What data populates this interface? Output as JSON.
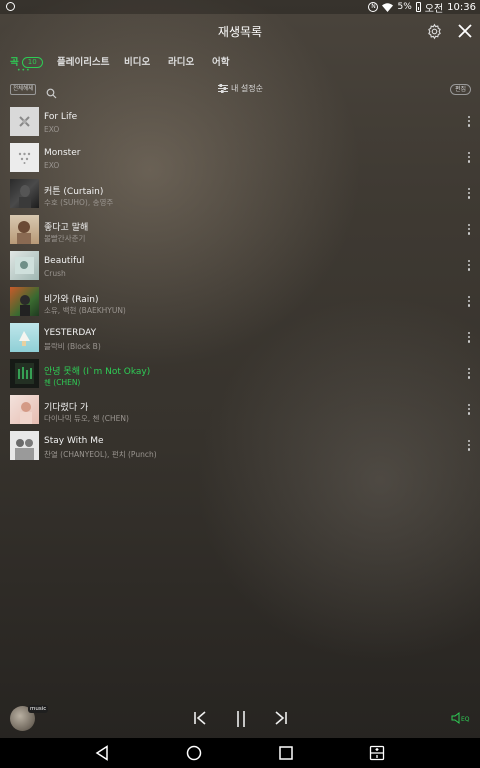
{
  "status_bar": {
    "battery": "5%",
    "time_prefix": "오전",
    "time": "10:36",
    "icons": [
      "app-ring-icon",
      "nfc-icon",
      "wifi-icon",
      "battery-icon"
    ]
  },
  "header": {
    "title": "재생목록",
    "icons": [
      "gear-icon",
      "close-icon"
    ]
  },
  "tabs": [
    {
      "label": "곡",
      "count": "10",
      "active": true
    },
    {
      "label": "플레이리스트",
      "active": false
    },
    {
      "label": "비디오",
      "active": false
    },
    {
      "label": "라디오",
      "active": false
    },
    {
      "label": "어학",
      "active": false
    }
  ],
  "toolbar": {
    "select_all": "전체해제",
    "sort_label": "내 설정순",
    "edit": "편집"
  },
  "songs": [
    {
      "title": "For Life",
      "artist": "EXO",
      "playing": false
    },
    {
      "title": "Monster",
      "artist": "EXO",
      "playing": false
    },
    {
      "title": "커튼 (Curtain)",
      "artist": "수호 (SUHO), 송영주",
      "playing": false
    },
    {
      "title": "좋다고 말해",
      "artist": "볼빨간사춘기",
      "playing": false
    },
    {
      "title": "Beautiful",
      "artist": "Crush",
      "playing": false
    },
    {
      "title": "비가와 (Rain)",
      "artist": "소유, 백현 (BAEKHYUN)",
      "playing": false
    },
    {
      "title": "YESTERDAY",
      "artist": "블락비 (Block B)",
      "playing": false
    },
    {
      "title": "안녕 못해 (I`m Not Okay)",
      "artist": "첸 (CHEN)",
      "playing": true
    },
    {
      "title": "기다렸다 가",
      "artist": "다이나믹 듀오, 첸 (CHEN)",
      "playing": false
    },
    {
      "title": "Stay With Me",
      "artist": "찬열 (CHANYEOL), 펀치 (Punch)",
      "playing": false
    }
  ],
  "player": {
    "badge": "music",
    "eq_label": "EQ",
    "icons": [
      "previous-icon",
      "pause-icon",
      "next-icon",
      "equalizer-icon"
    ]
  },
  "colors": {
    "accent": "#2ecc55",
    "navbar": "#000000"
  }
}
